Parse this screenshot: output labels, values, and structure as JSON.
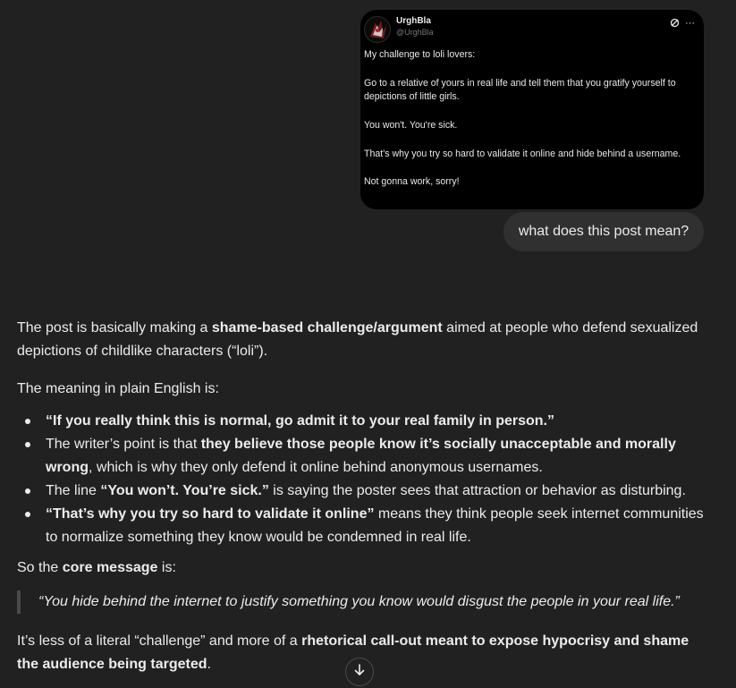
{
  "tweet": {
    "display_name": "UrghBla",
    "handle": "@UrghBla",
    "paragraphs": [
      "My challenge to loli lovers:",
      "Go to a relative of yours in real life and tell them that you gratify yourself to depictions of little girls.",
      "You won't. You're sick.",
      "That's why you try so hard to validate it online and hide behind a username.",
      "Not gonna work, sorry!"
    ],
    "icons": [
      "grok-icon",
      "more-icon"
    ]
  },
  "user_message": "what does this post mean?",
  "answer": {
    "intro": {
      "pre": "The post is basically making a ",
      "bold": "shame-based challenge/argument",
      "post": " aimed at people who defend sexualized depictions of childlike characters (“loli”)."
    },
    "meaning_heading": "The meaning in plain English is:",
    "bullets": [
      {
        "bold": "“If you really think this is normal, go admit it to your real family in person.”",
        "pre": "",
        "post": ""
      },
      {
        "pre": "The writer’s point is that ",
        "bold": "they believe those people know it’s socially unacceptable and morally wrong",
        "post": ", which is why they only defend it online behind anonymous usernames."
      },
      {
        "pre": "The line ",
        "bold": "“You won’t. You’re sick.”",
        "post": " is saying the poster sees that attraction or behavior as disturbing."
      },
      {
        "pre": "",
        "bold": "“That’s why you try so hard to validate it online”",
        "post": " means they think people seek internet communities to normalize something they know would be condemned in real life."
      }
    ],
    "core": {
      "pre": "So the ",
      "bold": "core message",
      "post": " is:"
    },
    "quote": "“You hide behind the internet to justify something you know would disgust the people in your real life.”",
    "closing": {
      "pre": "It’s less of a literal “challenge” and more of a ",
      "bold": "rhetorical call-out meant to expose hypocrisy and shame the audience being targeted",
      "post": "."
    }
  },
  "scroll_button_icon": "arrow-down-icon"
}
